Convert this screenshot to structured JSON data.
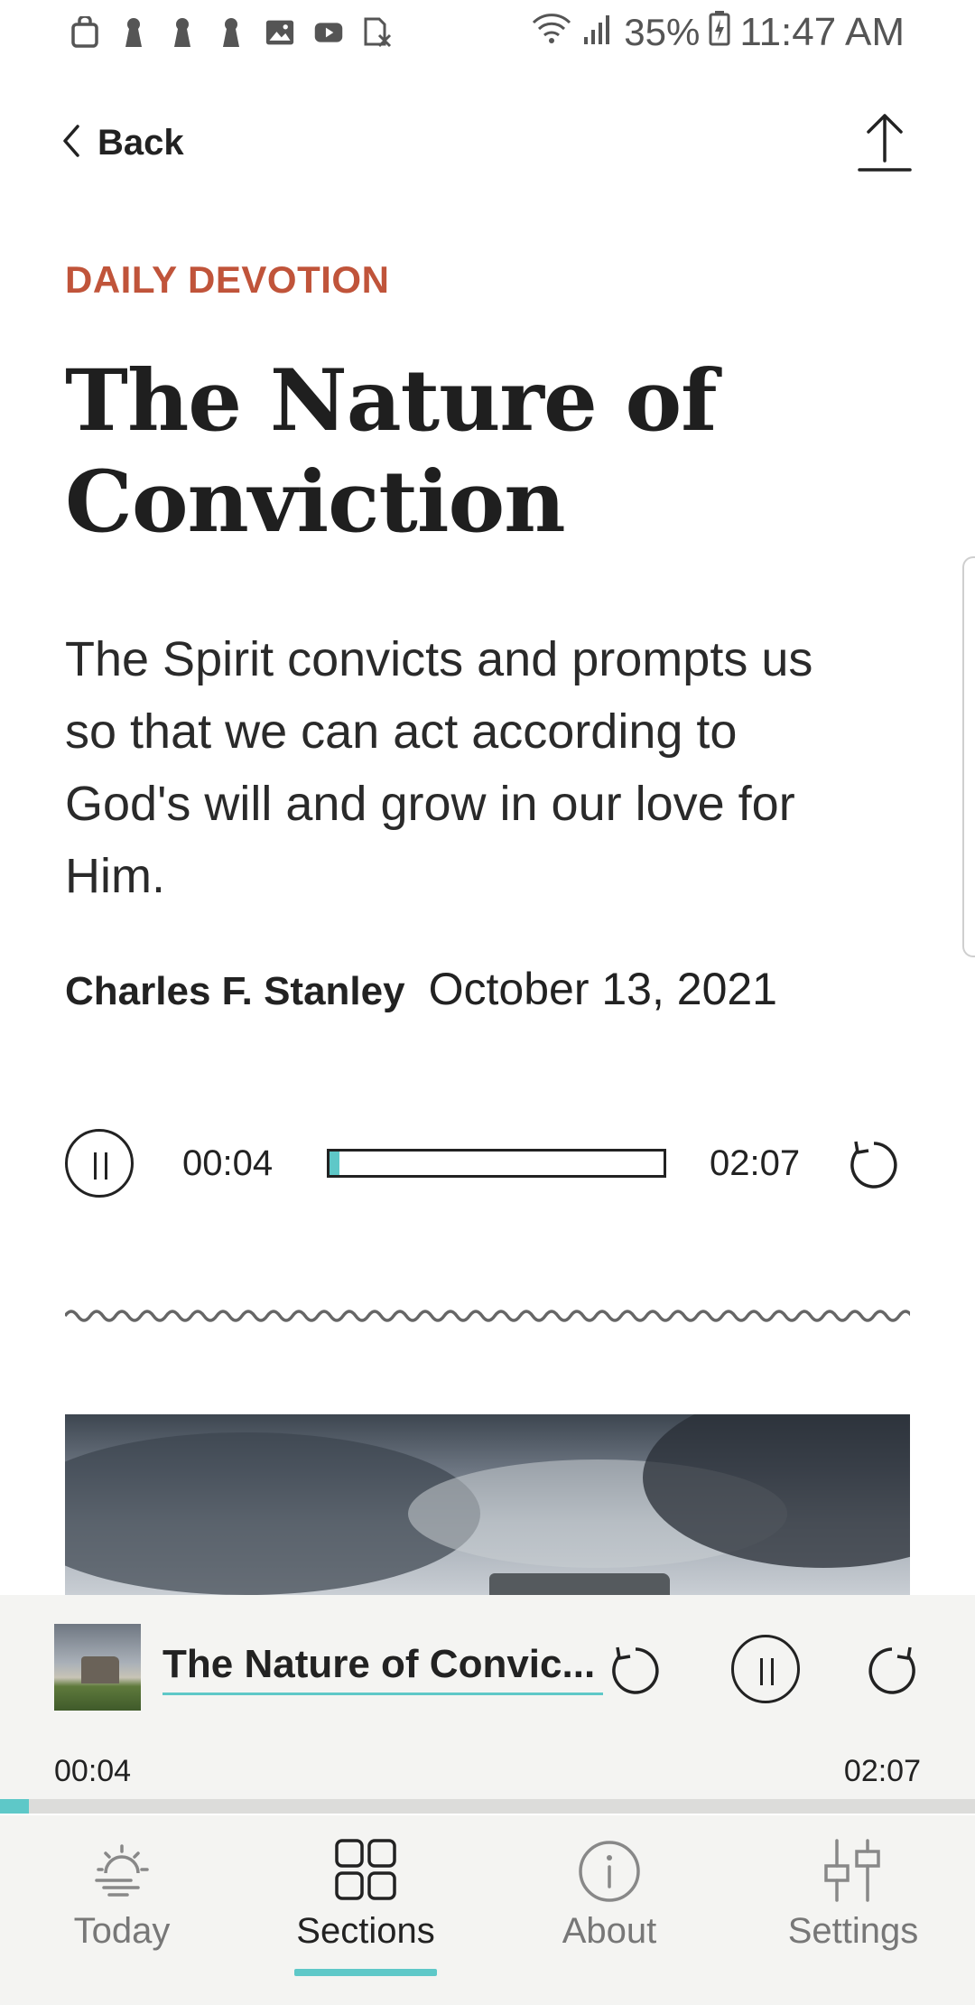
{
  "status_bar": {
    "left_icons": [
      "bag-icon",
      "keyhole-icon",
      "keyhole-icon",
      "keyhole-icon",
      "image-icon",
      "youtube-icon",
      "sim-icon"
    ],
    "battery": "35%",
    "time": "11:47 AM"
  },
  "header": {
    "back_label": "Back",
    "share_icon": "share-icon"
  },
  "article": {
    "eyebrow": "DAILY DEVOTION",
    "title": "The Nature of Conviction",
    "summary": "The Spirit convicts and prompts us so that we can act according to God's will and grow in our love for Him.",
    "author": "Charles F. Stanley",
    "date": "October 13, 2021"
  },
  "inline_player": {
    "elapsed": "00:04",
    "total": "02:07",
    "progress": 0.03
  },
  "mini_player": {
    "title": "The Nature of Convic...",
    "elapsed": "00:04",
    "total": "02:07",
    "progress": 0.03
  },
  "bottom_nav": {
    "items": [
      {
        "label": "Today",
        "icon": "sun-icon",
        "active": false
      },
      {
        "label": "Sections",
        "icon": "grid-icon",
        "active": true
      },
      {
        "label": "About",
        "icon": "info-icon",
        "active": false
      },
      {
        "label": "Settings",
        "icon": "sliders-icon",
        "active": false
      }
    ]
  },
  "colors": {
    "accent": "#5ec8c8",
    "eyebrow": "#c0543a",
    "text": "#222222",
    "nav_bg": "#f4f4f2"
  }
}
